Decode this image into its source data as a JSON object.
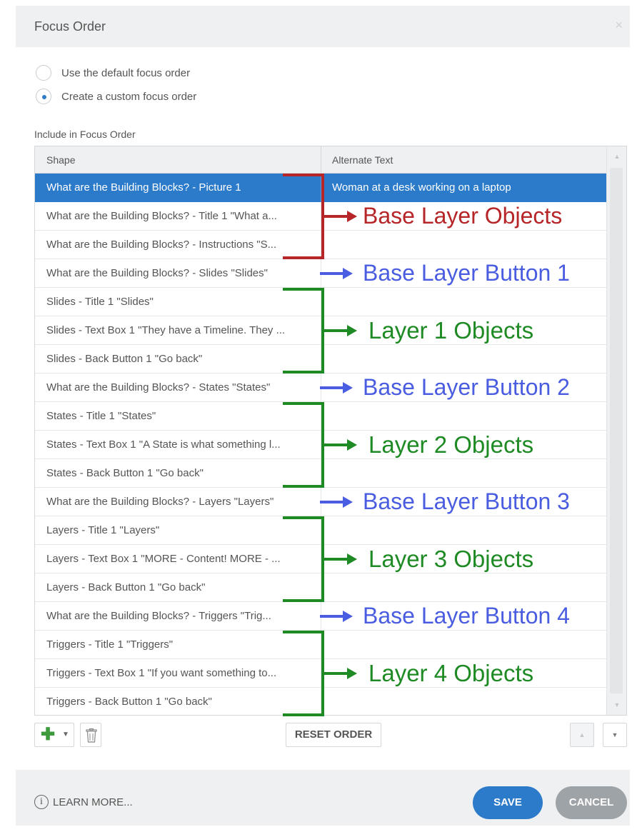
{
  "dialog": {
    "title": "Focus Order",
    "close_label": "×"
  },
  "options": [
    {
      "label": "Use the default focus order",
      "checked": false
    },
    {
      "label": "Create a custom focus order",
      "checked": true
    }
  ],
  "section_label": "Include in Focus Order",
  "table": {
    "headers": {
      "shape": "Shape",
      "alt": "Alternate Text"
    },
    "rows": [
      {
        "shape": "What are the Building Blocks?  - Picture 1",
        "alt": "Woman at a desk working on a laptop",
        "selected": true
      },
      {
        "shape": "What are the Building Blocks?  - Title 1 \"What a...",
        "alt": ""
      },
      {
        "shape": "What are the Building Blocks?  - Instructions \"S...",
        "alt": ""
      },
      {
        "shape": "What are the Building Blocks?  - Slides \"Slides\"",
        "alt": ""
      },
      {
        "shape": "Slides - Title 1 \"Slides\"",
        "alt": ""
      },
      {
        "shape": "Slides - Text Box 1 \"They have a Timeline. They ...",
        "alt": ""
      },
      {
        "shape": "Slides - Back Button 1 \"Go back\"",
        "alt": ""
      },
      {
        "shape": "What are the Building Blocks?  - States \"States\"",
        "alt": ""
      },
      {
        "shape": "States - Title 1 \"States\"",
        "alt": ""
      },
      {
        "shape": "States - Text Box 1 \"A State is what something l...",
        "alt": ""
      },
      {
        "shape": "States - Back Button 1 \"Go back\"",
        "alt": ""
      },
      {
        "shape": "What are the Building Blocks?  - Layers \"Layers\"",
        "alt": ""
      },
      {
        "shape": "Layers - Title 1 \"Layers\"",
        "alt": ""
      },
      {
        "shape": "Layers - Text Box 1 \"MORE - Content! MORE - ...",
        "alt": ""
      },
      {
        "shape": "Layers - Back Button 1 \"Go back\"",
        "alt": ""
      },
      {
        "shape": "What are the Building Blocks?  - Triggers \"Trig...",
        "alt": ""
      },
      {
        "shape": "Triggers - Title 1 \"Triggers\"",
        "alt": ""
      },
      {
        "shape": "Triggers - Text Box 1 \"If you want something to...",
        "alt": ""
      },
      {
        "shape": "Triggers - Back Button 1 \"Go back\"",
        "alt": ""
      }
    ]
  },
  "toolbar": {
    "add_icon": "plus-icon",
    "delete_icon": "trash-icon",
    "reset_label": "RESET ORDER",
    "move_up_icon": "triangle-up-icon",
    "move_down_icon": "triangle-down-icon"
  },
  "footer": {
    "learn_more": "LEARN MORE...",
    "info_icon_glyph": "i",
    "save_label": "SAVE",
    "cancel_label": "CANCEL"
  },
  "annotations": [
    {
      "text": "Base Layer Objects",
      "color": "#b62528",
      "kind": "bracket",
      "rows": [
        0,
        2
      ]
    },
    {
      "text": "Base Layer Button 1",
      "color": "#4a5de0",
      "kind": "arrow",
      "rows": [
        3,
        3
      ]
    },
    {
      "text": "Layer 1 Objects",
      "color": "#1e8a24",
      "kind": "bracket",
      "rows": [
        4,
        6
      ]
    },
    {
      "text": "Base Layer Button 2",
      "color": "#4a5de0",
      "kind": "arrow",
      "rows": [
        7,
        7
      ]
    },
    {
      "text": "Layer 2 Objects",
      "color": "#1e8a24",
      "kind": "bracket",
      "rows": [
        8,
        10
      ]
    },
    {
      "text": "Base Layer Button 3",
      "color": "#4a5de0",
      "kind": "arrow",
      "rows": [
        11,
        11
      ]
    },
    {
      "text": "Layer 3 Objects",
      "color": "#1e8a24",
      "kind": "bracket",
      "rows": [
        12,
        14
      ]
    },
    {
      "text": "Base Layer Button 4",
      "color": "#4a5de0",
      "kind": "arrow",
      "rows": [
        15,
        15
      ]
    },
    {
      "text": "Layer 4 Objects",
      "color": "#1e8a24",
      "kind": "bracket",
      "rows": [
        16,
        18
      ]
    }
  ],
  "colors": {
    "accent": "#2c7bca",
    "cancel": "#9ea3a7",
    "add_green": "#3d9a3d"
  }
}
